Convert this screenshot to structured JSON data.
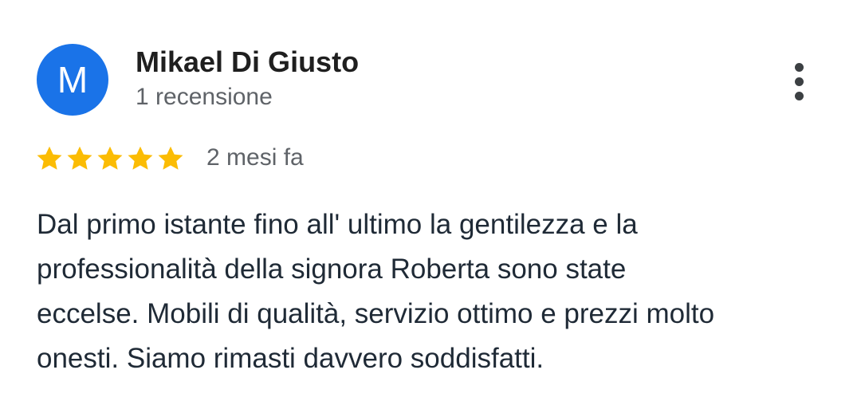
{
  "author": {
    "initial": "M",
    "name": "Mikael Di Giusto",
    "review_count": "1 recensione"
  },
  "rating": {
    "stars": 5,
    "max": 5,
    "star_color": "#fbbc04",
    "icon": "star-icon"
  },
  "review": {
    "time": "2 mesi fa",
    "lines": [
      "Dal primo istante fino all' ultimo la gentilezza e la",
      "professionalità della signora Roberta sono state",
      "eccelse. Mobili di qualità, servizio ottimo e prezzi molto",
      "onesti. Siamo rimasti davvero soddisfatti."
    ]
  },
  "menu": {
    "icon": "more-vert-icon"
  },
  "colors": {
    "avatar_bg": "#1a73e8",
    "text_primary": "#1f1f1f",
    "text_secondary": "#5f6368"
  }
}
